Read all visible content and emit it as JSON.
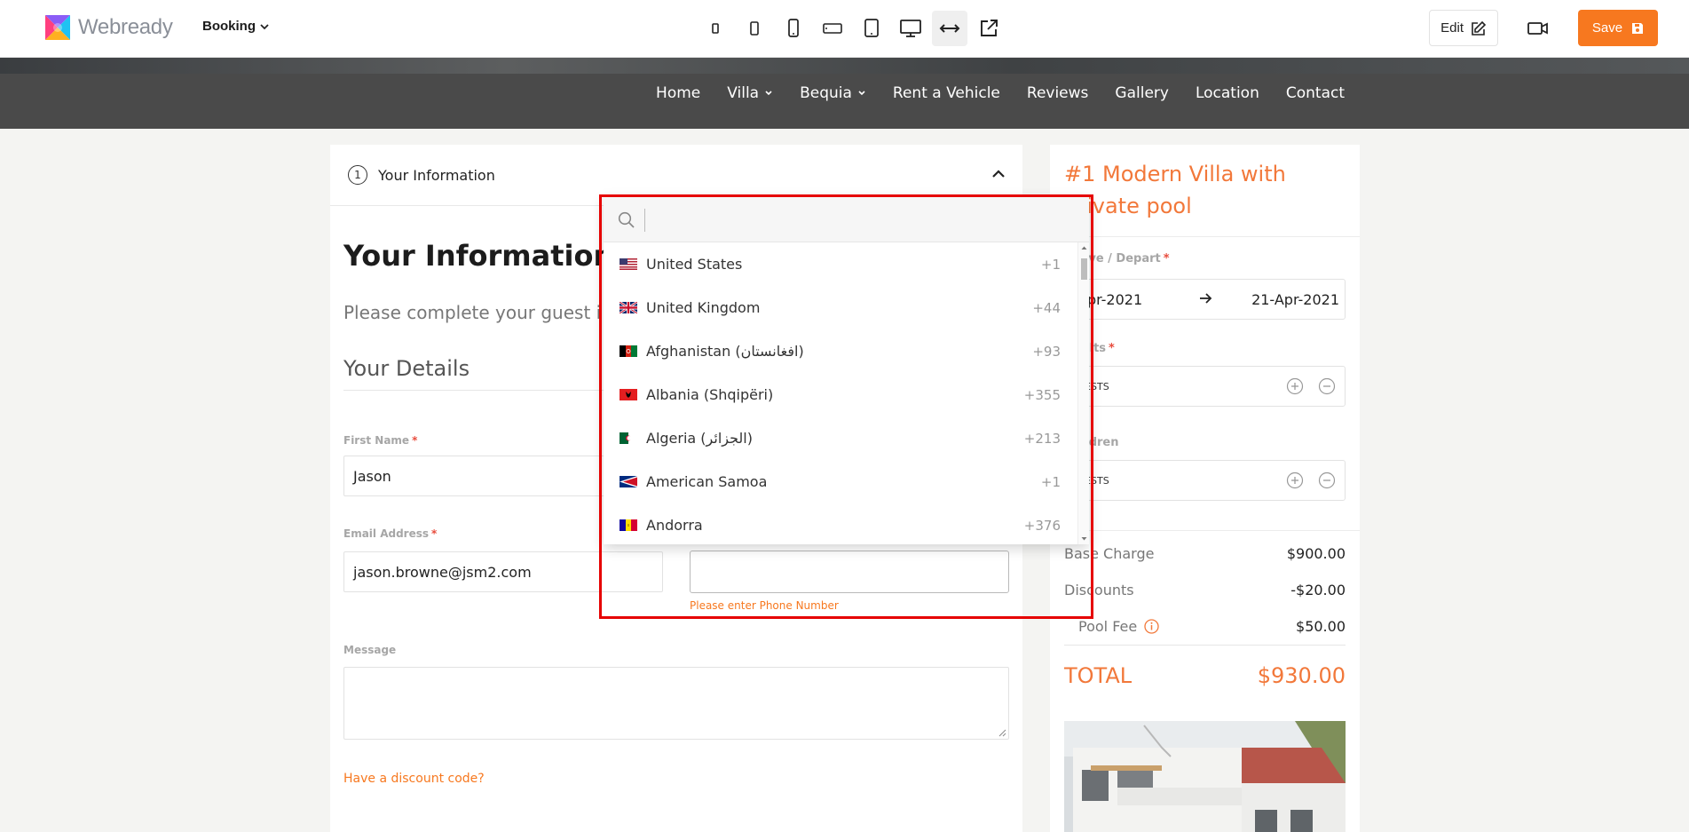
{
  "editor": {
    "brand": "Webready",
    "page_selector": "Booking",
    "device_icons": [
      "phone-small-icon",
      "phone-icon",
      "phone-large-icon",
      "phone-landscape-icon",
      "tablet-icon",
      "desktop-icon",
      "full-width-icon",
      "open-external-icon"
    ],
    "edit_label": "Edit",
    "save_label": "Save",
    "accent": "#f7781f"
  },
  "site_nav": {
    "items": [
      {
        "label": "Home"
      },
      {
        "label": "Villa"
      },
      {
        "label": "Bequia"
      },
      {
        "label": "Rent a Vehicle"
      },
      {
        "label": "Reviews"
      },
      {
        "label": "Gallery"
      },
      {
        "label": "Location"
      },
      {
        "label": "Contact"
      }
    ]
  },
  "form": {
    "step_number": "1",
    "step_title": "Your Information",
    "heading": "Your Information",
    "intro": "Please complete your guest i",
    "details_heading": "Your Details",
    "first_name_label": "First Name",
    "first_name_value": "Jason",
    "email_label": "Email Address",
    "email_value": "jason.browne@jsm2.com",
    "phone_value": "",
    "phone_error": "Please enter Phone Number",
    "message_label": "Message",
    "message_value": "",
    "discount_link": "Have a discount code?",
    "required_mark": "*"
  },
  "summary": {
    "title": "#1 Modern Villa with private pool",
    "dates_label": "Arrive / Depart",
    "arrive": "Apr-2021",
    "depart": "21-Apr-2021",
    "adults_label": "Adults",
    "adults_value": "UESTS",
    "children_label": "Children",
    "children_value": "UESTS",
    "base_charge_label": "Base Charge",
    "base_charge_value": "$900.00",
    "discounts_label": "Discounts",
    "discounts_value": "-$20.00",
    "pool_fee_label": "Pool Fee",
    "pool_fee_value": "$50.00",
    "total_label": "TOTAL",
    "total_value": "$930.00",
    "accent": "#f2783a"
  },
  "country_dropdown": {
    "search_value": "",
    "countries": [
      {
        "name": "United States",
        "code": "+1"
      },
      {
        "name": "United Kingdom",
        "code": "+44"
      },
      {
        "name": "Afghanistan (‫افغانستان‬‎)",
        "code": "+93"
      },
      {
        "name": "Albania (Shqipëri)",
        "code": "+355"
      },
      {
        "name": "Algeria (‫الجزائر‬‎)",
        "code": "+213"
      },
      {
        "name": "American Samoa",
        "code": "+1"
      },
      {
        "name": "Andorra",
        "code": "+376"
      }
    ]
  }
}
